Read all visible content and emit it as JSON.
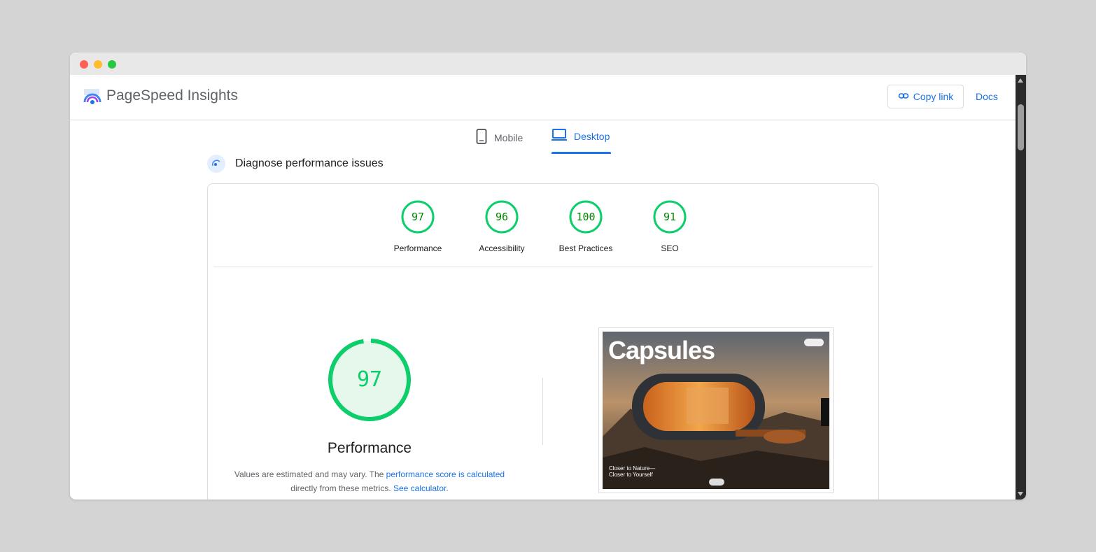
{
  "header": {
    "app_title": "PageSpeed Insights",
    "copy_link_label": "Copy link",
    "docs_label": "Docs"
  },
  "tabs": [
    {
      "label": "Mobile",
      "active": false
    },
    {
      "label": "Desktop",
      "active": true
    }
  ],
  "section": {
    "title": "Diagnose performance issues"
  },
  "categories": [
    {
      "score": "97",
      "label": "Performance"
    },
    {
      "score": "96",
      "label": "Accessibility"
    },
    {
      "score": "100",
      "label": "Best Practices"
    },
    {
      "score": "91",
      "label": "SEO"
    }
  ],
  "performance": {
    "score": "97",
    "title": "Performance",
    "note_prefix": "Values are estimated and may vary. The ",
    "note_link1": "performance score is calculated",
    "note_middle": " directly from these metrics. ",
    "note_link2": "See calculator",
    "note_suffix": "."
  },
  "screenshot": {
    "brand": "Capsules",
    "tagline": "Closer to Nature—Closer to Yourself"
  },
  "colors": {
    "pass": "#0cce6b",
    "pass_text": "#008800",
    "accent": "#1a73e8"
  }
}
